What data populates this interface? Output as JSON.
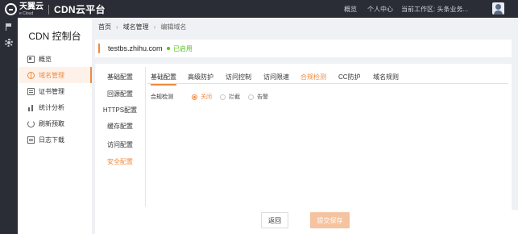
{
  "topbar": {
    "logo_cn": "天翼云",
    "logo_en": "e Cloud",
    "platform": "CDN云平台",
    "links": [
      "概览",
      "个人中心"
    ],
    "workspace": "当前工作区: 头条业务..."
  },
  "sidebar": {
    "title": "CDN 控制台",
    "items": [
      {
        "label": "概览",
        "icon": "overview-icon"
      },
      {
        "label": "域名管理",
        "icon": "domain-icon"
      },
      {
        "label": "证书管理",
        "icon": "certificate-icon"
      },
      {
        "label": "统计分析",
        "icon": "stats-icon"
      },
      {
        "label": "刷新预取",
        "icon": "refresh-icon"
      },
      {
        "label": "日志下载",
        "icon": "log-icon"
      }
    ]
  },
  "breadcrumb": [
    "首页",
    "域名管理",
    "编辑域名"
  ],
  "domain": {
    "name": "testbs.zhihu.com",
    "status": "已启用"
  },
  "vnav": [
    "基础配置",
    "回源配置",
    "HTTPS配置",
    "缓存配置",
    "访问配置",
    "安全配置"
  ],
  "tabs": [
    "基础配置",
    "高级防护",
    "访问控制",
    "访问限速",
    "合规检测",
    "CC防护",
    "域名规则"
  ],
  "compliance": {
    "label": "合规检测",
    "options": [
      "关闭",
      "拦截",
      "告警"
    ],
    "selected": "关闭"
  },
  "buttons": {
    "back": "返回",
    "submit": "提交保存"
  },
  "colors": {
    "accent": "#f08a3e",
    "topbar": "#2a2d36",
    "status": "#52c41a",
    "submit_disabled": "#f6c3a0"
  }
}
